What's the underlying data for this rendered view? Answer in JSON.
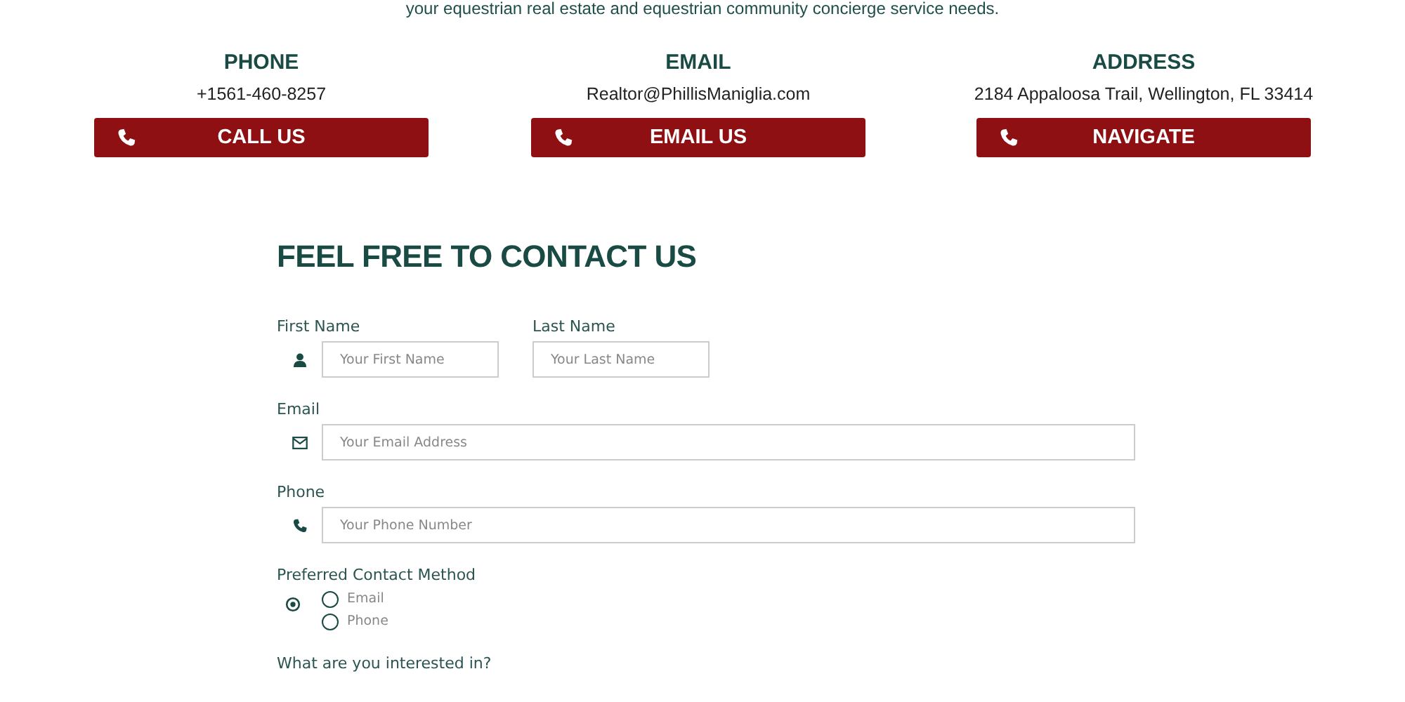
{
  "intro": {
    "text": "your equestrian real estate and equestrian community concierge service needs."
  },
  "contacts": [
    {
      "heading": "PHONE",
      "value": "+1561-460-8257",
      "button": "CALL US"
    },
    {
      "heading": "EMAIL",
      "value": "Realtor@PhillisManiglia.com",
      "button": "EMAIL US"
    },
    {
      "heading": "ADDRESS",
      "value": "2184 Appaloosa Trail, Wellington, FL 33414",
      "button": "NAVIGATE"
    }
  ],
  "form": {
    "title": "FEEL FREE TO CONTACT US",
    "fields": [
      {
        "kind": "name",
        "label": "First Name",
        "placeholder": "Your First Name",
        "label2": "Last Name",
        "placeholder2": "Your Last Name"
      },
      {
        "kind": "email",
        "label": "Email",
        "placeholder": "Your Email Address"
      },
      {
        "kind": "phone",
        "label": "Phone",
        "placeholder": "Your Phone Number"
      }
    ],
    "contact_method": {
      "label": "Preferred Contact Method",
      "options": [
        {
          "label": "Email",
          "selected": false
        },
        {
          "label": "Phone",
          "selected": false
        }
      ]
    },
    "interest": {
      "label": "What are you interested in?"
    }
  }
}
